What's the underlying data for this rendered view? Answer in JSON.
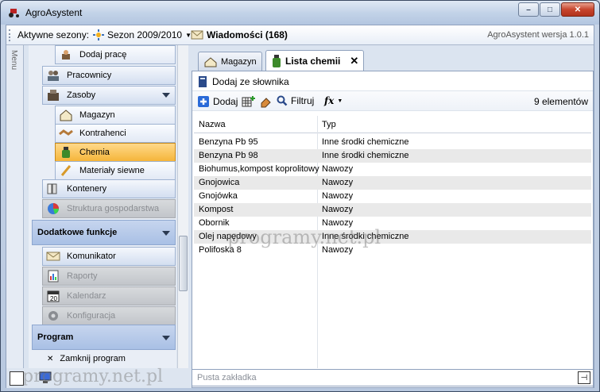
{
  "window": {
    "title": "AgroAsystent"
  },
  "toolbar": {
    "seasons_label": "Aktywne sezony:",
    "season_value": "Sezon 2009/2010",
    "news_label": "Wiadomości (168)",
    "version": "AgroAsystent wersja 1.0.1"
  },
  "menu_strip": {
    "label": "Menu"
  },
  "sidebar": {
    "items": [
      {
        "label": "Dodaj pracę",
        "icon": "hammer-icon"
      },
      {
        "label": "Pracownicy",
        "icon": "people-icon"
      },
      {
        "label": "Zasoby",
        "icon": "resources-icon"
      },
      {
        "label": "Magazyn",
        "icon": "warehouse-icon"
      },
      {
        "label": "Kontrahenci",
        "icon": "handshake-icon"
      },
      {
        "label": "Chemia",
        "icon": "bottle-icon"
      },
      {
        "label": "Materiały siewne",
        "icon": "seed-icon"
      },
      {
        "label": "Kontenery",
        "icon": "containers-icon"
      },
      {
        "label": "Struktura gospodarstwa",
        "icon": "pie-chart-icon"
      }
    ],
    "section_extra": "Dodatkowe funkcje",
    "extra_items": [
      {
        "label": "Komunikator",
        "icon": "envelope-icon"
      },
      {
        "label": "Raporty",
        "icon": "report-icon"
      },
      {
        "label": "Kalendarz",
        "icon": "calendar-icon"
      },
      {
        "label": "Konfiguracja",
        "icon": "gear-icon"
      }
    ],
    "section_program": "Program",
    "close_label": "Zamknij program"
  },
  "tabs": [
    {
      "label": "Magazyn"
    },
    {
      "label": "Lista chemii"
    }
  ],
  "panel": {
    "dict_label": "Dodaj ze słownika",
    "add_label": "Dodaj",
    "filter_label": "Filtruj",
    "fx_label": "fx",
    "count": "9 elementów"
  },
  "grid": {
    "columns": [
      "Nazwa",
      "Typ"
    ],
    "rows": [
      [
        "Benzyna Pb 95",
        "Inne środki chemiczne"
      ],
      [
        "Benzyna Pb 98",
        "Inne środki chemiczne"
      ],
      [
        "Biohumus,kompost koprolitowy",
        "Nawozy"
      ],
      [
        "Gnojowica",
        "Nawozy"
      ],
      [
        "Gnojówka",
        "Nawozy"
      ],
      [
        "Kompost",
        "Nawozy"
      ],
      [
        "Obornik",
        "Nawozy"
      ],
      [
        "Olej napędowy",
        "Inne środki chemiczne"
      ],
      [
        "Polifoska 8",
        "Nawozy"
      ]
    ]
  },
  "empty_tab": "Pusta zakładka",
  "watermark": "programy.net.pl"
}
